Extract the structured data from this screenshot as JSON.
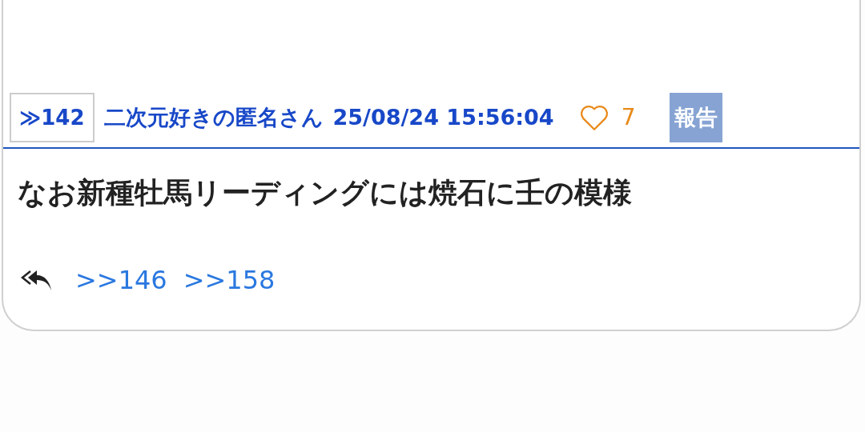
{
  "post": {
    "number": "≫142",
    "author": "二次元好きの匿名さん",
    "timestamp": "25/08/24 15:56:04",
    "likes": "7",
    "report": "報告",
    "body": "なお新種牡馬リーディングには焼石に壬の模様",
    "replies": [
      ">>146",
      ">>158"
    ]
  }
}
